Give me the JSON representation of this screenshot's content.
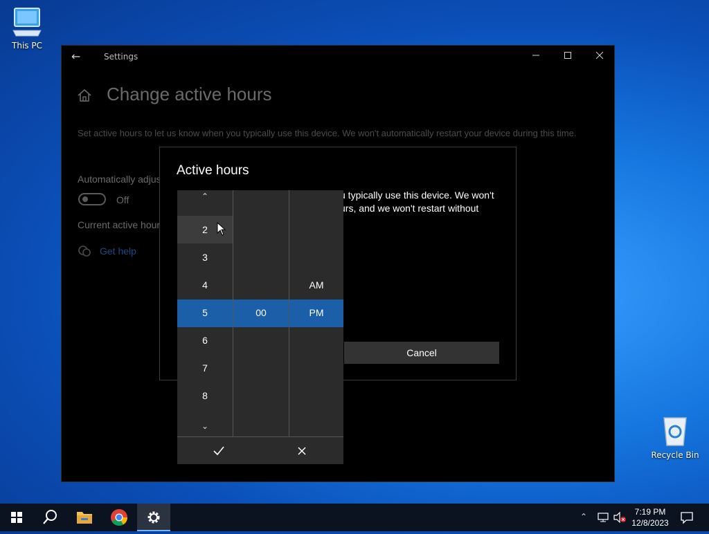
{
  "desktop": {
    "icons": [
      {
        "label": "This PC"
      },
      {
        "label": "Recycle Bin"
      }
    ]
  },
  "settings_window": {
    "app_title": "Settings",
    "page_title": "Change active hours",
    "description": "Set active hours to let us know when you typically use this device. We won't automatically restart your device during this time.",
    "auto_adjust_label": "Automatically adjus",
    "toggle_state": "Off",
    "current_hours_label": "Current active hour",
    "get_help": "Get help"
  },
  "dialog": {
    "title": "Active hours",
    "text": "u typically use this device. We won't urs, and we won't restart without",
    "cancel_label": "Cancel"
  },
  "time_picker": {
    "hours": [
      "2",
      "3",
      "4",
      "5",
      "6",
      "7",
      "8"
    ],
    "selected_hour": "5",
    "selected_minute": "00",
    "ampm_options": [
      "AM",
      "PM"
    ],
    "selected_ampm": "PM"
  },
  "taskbar": {
    "clock_time": "7:19 PM",
    "clock_date": "12/8/2023",
    "active_app": "Settings"
  },
  "colors": {
    "selection": "#1a5fa8",
    "picker_bg": "#2b2b2b",
    "taskbar_bg": "#0b1220"
  }
}
